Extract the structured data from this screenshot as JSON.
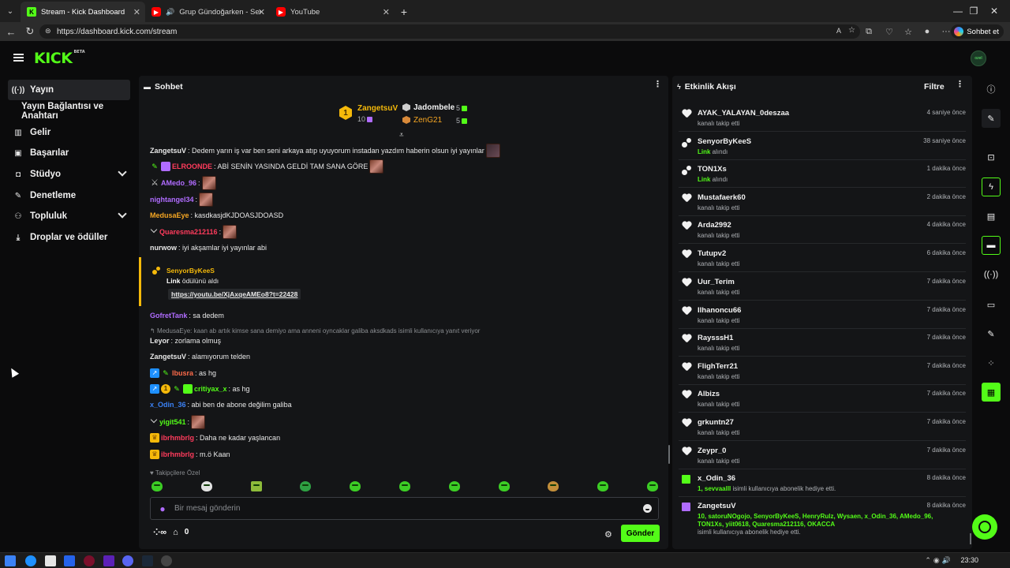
{
  "browser": {
    "tabs": [
      {
        "title": "Stream - Kick Dashboard",
        "favicon": "kick-icon",
        "active": true
      },
      {
        "title": "Grup Gündoğarken - Sen Ben...",
        "favicon": "youtube-icon",
        "active": false
      },
      {
        "title": "YouTube",
        "favicon": "youtube-icon",
        "active": false
      }
    ],
    "url": "https://dashboard.kick.com/stream",
    "copilot_label": "Sohbet et"
  },
  "header": {
    "logo": "KICK",
    "logo_badge": "BETA",
    "avatar_text": "ozel"
  },
  "sidebar": {
    "items": [
      {
        "label": "Yayın",
        "icon": "broadcast-icon",
        "active": true
      },
      {
        "label": "Yayın Bağlantısı ve Anahtarı",
        "icon": "",
        "active": false
      },
      {
        "label": "Gelir",
        "icon": "chart-icon",
        "active": false
      },
      {
        "label": "Başarılar",
        "icon": "trophy-icon",
        "active": false
      },
      {
        "label": "Stüdyo",
        "icon": "studio-icon",
        "active": false,
        "expandable": true
      },
      {
        "label": "Denetleme",
        "icon": "wrench-icon",
        "active": false
      },
      {
        "label": "Topluluk",
        "icon": "community-icon",
        "active": false,
        "expandable": true
      },
      {
        "label": "Droplar ve ödüller",
        "icon": "drops-icon",
        "active": false
      }
    ]
  },
  "chat": {
    "title": "Sohbet",
    "leaderboard": {
      "first": {
        "name": "ZangetsuV",
        "count": "10",
        "rank": "1"
      },
      "second": {
        "name": "Jadombele",
        "count": "5"
      },
      "third": {
        "name": "ZenG21",
        "count": "5"
      }
    },
    "messages": [
      {
        "user": "ZangetsuV",
        "color": "#e8e8e8",
        "text": ": Dedem yarın iş var ben seni arkaya atıp uyuyorum instadan yazdım haberin olsun iyi yayınlar"
      },
      {
        "user": "ELROONDE",
        "color": "#ff3b5c",
        "text": ": ABİ SENİN YASINDA GELDİ TAM SANA GÖRE"
      },
      {
        "user": "AMedo_96",
        "color": "#b06cff",
        "text": ":"
      },
      {
        "user": "nightangel34",
        "color": "#b06cff",
        "text": ":"
      },
      {
        "user": "MedusaEye",
        "color": "#f5a623",
        "text": ": kasdkasjdKJDOASJDOASD"
      },
      {
        "user": "Quaresma212116",
        "color": "#ff3b5c",
        "text": ":"
      },
      {
        "user": "nurwow",
        "color": "#e8e8e8",
        "text": ": iyi akşamlar iyi yayınlar abi"
      },
      {
        "user": "GofretTank",
        "color": "#b06cff",
        "text": ": sa dedem"
      },
      {
        "user": "Leyor",
        "color": "#e8e8e8",
        "text": ": zorlama olmuş"
      },
      {
        "user": "ZangetsuV",
        "color": "#e8e8e8",
        "text": ": alamıyorum telden"
      },
      {
        "user": "lbusra",
        "color": "#ff6b4a",
        "text": ": as hg"
      },
      {
        "user": "critiyax_x",
        "color": "#53fc18",
        "text": ": as hg"
      },
      {
        "user": "x_Odin_36",
        "color": "#3b82f6",
        "text": ": abi ben de abone değilim galiba"
      },
      {
        "user": "yigit541",
        "color": "#53fc18",
        "text": ":"
      },
      {
        "user": "ibrhmbrlg",
        "color": "#ff3b5c",
        "text": ": Daha ne kadar yaşlancan"
      },
      {
        "user": "ibrhmbrlg",
        "color": "#ff3b5c",
        "text": ": m.ö Kaan"
      }
    ],
    "reward": {
      "user": "SenyorByKeeS",
      "reward_name": "Link",
      "reward_text": " ödülünü aldı",
      "link": "https://youtu.be/XjAxqeAMEo8?t=22428"
    },
    "reply_context": "MedusaEye: kaan ab artık kimse sana demiyo ama anneni oyncaklar galiba aksdkads isimli kullanıcıya yanıt veriyor",
    "follower_only": "Takipçilere Özel",
    "input_placeholder": "Bir mesaj gönderin",
    "points": "0",
    "send_label": "Gönder"
  },
  "activity": {
    "title": "Etkinlik Akışı",
    "filter_label": "Filtre",
    "events": [
      {
        "user": "AYAK_YALAYAN_0deszaa",
        "desc": "kanalı takip etti",
        "time": "4 saniye önce",
        "type": "follow"
      },
      {
        "user": "SenyorByKeeS",
        "highlight": "Link",
        "desc": " alındı",
        "time": "38 saniye önce",
        "type": "reward"
      },
      {
        "user": "TON1Xs",
        "highlight": "Link",
        "desc": " alındı",
        "time": "1 dakika önce",
        "type": "reward"
      },
      {
        "user": "Mustafaerk60",
        "desc": "kanalı takip etti",
        "time": "2 dakika önce",
        "type": "follow"
      },
      {
        "user": "Arda2992",
        "desc": "kanalı takip etti",
        "time": "4 dakika önce",
        "type": "follow"
      },
      {
        "user": "Tutupv2",
        "desc": "kanalı takip etti",
        "time": "6 dakika önce",
        "type": "follow"
      },
      {
        "user": "Uur_Terim",
        "desc": "kanalı takip etti",
        "time": "7 dakika önce",
        "type": "follow"
      },
      {
        "user": "Ilhanoncu66",
        "desc": "kanalı takip etti",
        "time": "7 dakika önce",
        "type": "follow"
      },
      {
        "user": "RaysssH1",
        "desc": "kanalı takip etti",
        "time": "7 dakika önce",
        "type": "follow"
      },
      {
        "user": "FlighTerr21",
        "desc": "kanalı takip etti",
        "time": "7 dakika önce",
        "type": "follow"
      },
      {
        "user": "Albizs",
        "desc": "kanalı takip etti",
        "time": "7 dakika önce",
        "type": "follow"
      },
      {
        "user": "grkuntn27",
        "desc": "kanalı takip etti",
        "time": "7 dakika önce",
        "type": "follow"
      },
      {
        "user": "Zeypr_0",
        "desc": "kanalı takip etti",
        "time": "7 dakika önce",
        "type": "follow"
      },
      {
        "user": "x_Odin_36",
        "highlight": "1, sevvaalll",
        "desc": " isimli kullanıcıya abonelik hediye etti.",
        "time": "8 dakika önce",
        "type": "gift"
      },
      {
        "user": "ZangetsuV",
        "highlight": "10, satoruNOgojo, SenyorByKeeS, HenryRulz, Wysaen, x_Odin_36, AMedo_96, TON1Xs, yiit0618, Quaresma212116, OKACCA",
        "desc": " isimli kullanıcıya abonelik hediye etti.",
        "time": "8 dakika önce",
        "type": "gift-multi"
      }
    ]
  },
  "taskbar": {
    "time": "23:30"
  },
  "colors": {
    "accent": "#53fc18",
    "panel": "#141517",
    "bg": "#0b0b0c",
    "gold": "#f5b90a",
    "purple": "#b06cff"
  }
}
